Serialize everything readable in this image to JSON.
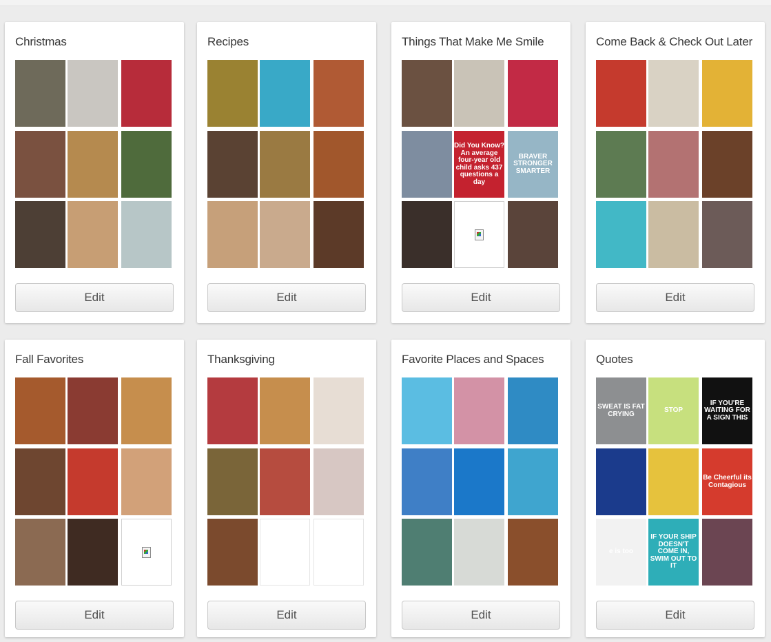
{
  "boards": [
    {
      "title": "Christmas",
      "edit_label": "Edit",
      "thumbs": [
        {
          "icon": "craft-supplies",
          "color": "#6e6a5a"
        },
        {
          "icon": "gift-ideas-article",
          "color": "#c9c6c1",
          "text": ""
        },
        {
          "icon": "candy-wrapped-gifts",
          "color": "#b72c3a"
        },
        {
          "icon": "felt-ornaments",
          "color": "#7a5140"
        },
        {
          "icon": "snack-mix",
          "color": "#b58a4f"
        },
        {
          "icon": "tree-cake",
          "color": "#4f6b3c"
        },
        {
          "icon": "family-photo",
          "color": "#4d3f35"
        },
        {
          "icon": "cookie-tree",
          "color": "#c79e74"
        },
        {
          "icon": "holiday-cookies",
          "color": "#b7c6c7"
        }
      ]
    },
    {
      "title": "Recipes",
      "edit_label": "Edit",
      "thumbs": [
        {
          "icon": "zucchini-bake",
          "color": "#9a8232"
        },
        {
          "icon": "snowflake-pops",
          "color": "#39a9c7"
        },
        {
          "icon": "soup-bowl",
          "color": "#b05a34"
        },
        {
          "icon": "cookies-cream-bars",
          "color": "#5a4233"
        },
        {
          "icon": "sandwich",
          "color": "#9a7a42"
        },
        {
          "icon": "chicken-dish",
          "color": "#a1572c"
        },
        {
          "icon": "pancake-stack",
          "color": "#c6a07a"
        },
        {
          "icon": "crackers",
          "color": "#c9aa8d"
        },
        {
          "icon": "brownie",
          "color": "#5c3a28"
        }
      ]
    },
    {
      "title": "Things That Make Me Smile",
      "edit_label": "Edit",
      "thumbs": [
        {
          "icon": "party-drinks",
          "color": "#6b5141"
        },
        {
          "icon": "couple-photo",
          "color": "#c9c3b7"
        },
        {
          "icon": "pink-cake",
          "color": "#c22a45"
        },
        {
          "icon": "wedding-cake-topper",
          "color": "#7e8da0"
        },
        {
          "icon": "did-you-know-card",
          "color": "#c4222f",
          "text": "Did You Know? An average four-year old child asks 437 questions a day"
        },
        {
          "icon": "braver-stronger-quote",
          "color": "#96b6c6",
          "text": "BRAVER STRONGER SMARTER"
        },
        {
          "icon": "love-letters-photo",
          "color": "#3a2f2a"
        },
        {
          "icon": "broken-image",
          "color": "#ffffff",
          "broken": true
        },
        {
          "icon": "baby-photo",
          "color": "#5a443a"
        }
      ]
    },
    {
      "title": "Come Back & Check Out Later",
      "edit_label": "Edit",
      "thumbs": [
        {
          "icon": "kid-craft",
          "color": "#c53a2d"
        },
        {
          "icon": "tv-room",
          "color": "#d9d2c4"
        },
        {
          "icon": "gnome-figurine",
          "color": "#e3b236"
        },
        {
          "icon": "water-bottle-kid",
          "color": "#5d7b52"
        },
        {
          "icon": "bagged-snacks",
          "color": "#b37272"
        },
        {
          "icon": "seed-pot",
          "color": "#6b4129"
        },
        {
          "icon": "colorful-drinks",
          "color": "#42b8c6"
        },
        {
          "icon": "kitchen-interior",
          "color": "#cabca2"
        },
        {
          "icon": "glass-orb",
          "color": "#6c5b58"
        }
      ]
    },
    {
      "title": "Fall Favorites",
      "edit_label": "Edit",
      "thumbs": [
        {
          "icon": "caramel-cookies",
          "color": "#a55a2d"
        },
        {
          "icon": "trail-mix-bowl",
          "color": "#8a3b32"
        },
        {
          "icon": "pumpkin-pancakes",
          "color": "#c68e4d"
        },
        {
          "icon": "caramel-dessert",
          "color": "#6e4630"
        },
        {
          "icon": "kid-craft",
          "color": "#c53a2d"
        },
        {
          "icon": "pumpkin-cookies",
          "color": "#d2a179"
        },
        {
          "icon": "pumpkin-bars",
          "color": "#8b6a52"
        },
        {
          "icon": "chocolate-truffles",
          "color": "#3f2b22"
        },
        {
          "icon": "broken-image",
          "color": "#ffffff",
          "broken": true
        }
      ]
    },
    {
      "title": "Thanksgiving",
      "edit_label": "Edit",
      "thumbs": [
        {
          "icon": "cranberry-dip",
          "color": "#b43b3f"
        },
        {
          "icon": "pumpkin-pancakes",
          "color": "#c68e4d"
        },
        {
          "icon": "hat-cookies",
          "color": "#e7ddd4"
        },
        {
          "icon": "muffin-tin",
          "color": "#7a6539"
        },
        {
          "icon": "cranberry-crisp",
          "color": "#b64c3f"
        },
        {
          "icon": "cupcakes",
          "color": "#d7c7c3"
        },
        {
          "icon": "turkey-pops",
          "color": "#7b4a2d"
        },
        {
          "icon": "blank",
          "color": "#ffffff",
          "blank": true
        },
        {
          "icon": "blank",
          "color": "#ffffff",
          "blank": true
        }
      ]
    },
    {
      "title": "Favorite Places and Spaces",
      "edit_label": "Edit",
      "thumbs": [
        {
          "icon": "beach-view",
          "color": "#5bbde2"
        },
        {
          "icon": "tree-path",
          "color": "#d392a6"
        },
        {
          "icon": "tropical-island",
          "color": "#2f8bc4"
        },
        {
          "icon": "blue-sky",
          "color": "#3f7fc6"
        },
        {
          "icon": "ocean-huts",
          "color": "#1b78c9"
        },
        {
          "icon": "boat-water",
          "color": "#3fa5cf"
        },
        {
          "icon": "painted-trees",
          "color": "#4f7e72"
        },
        {
          "icon": "white-staircase",
          "color": "#d7dad6"
        },
        {
          "icon": "wood-doors",
          "color": "#8a4f2c"
        }
      ]
    },
    {
      "title": "Quotes",
      "edit_label": "Edit",
      "thumbs": [
        {
          "icon": "sweat-quote",
          "color": "#8d8f91",
          "text": "SWEAT IS FAT CRYING"
        },
        {
          "icon": "stop-quote",
          "color": "#c7e07e",
          "text": "STOP"
        },
        {
          "icon": "waiting-sign-quote",
          "color": "#111111",
          "text": "IF YOU'RE WAITING FOR A SIGN THIS"
        },
        {
          "icon": "butterfly-quote",
          "color": "#1b3b8c"
        },
        {
          "icon": "yellow-quote",
          "color": "#e6c23d"
        },
        {
          "icon": "be-cheerful-quote",
          "color": "#d53b2d",
          "text": "Be Cheerful its Contagious"
        },
        {
          "icon": "life-is-too-short-quote",
          "color": "#f2f2f2",
          "text": "e is too"
        },
        {
          "icon": "ship-quote",
          "color": "#2eaeb8",
          "text": "IF YOUR SHIP DOESN'T COME IN, SWIM OUT TO IT"
        },
        {
          "icon": "happiness-quote",
          "color": "#6b4552"
        }
      ]
    }
  ]
}
